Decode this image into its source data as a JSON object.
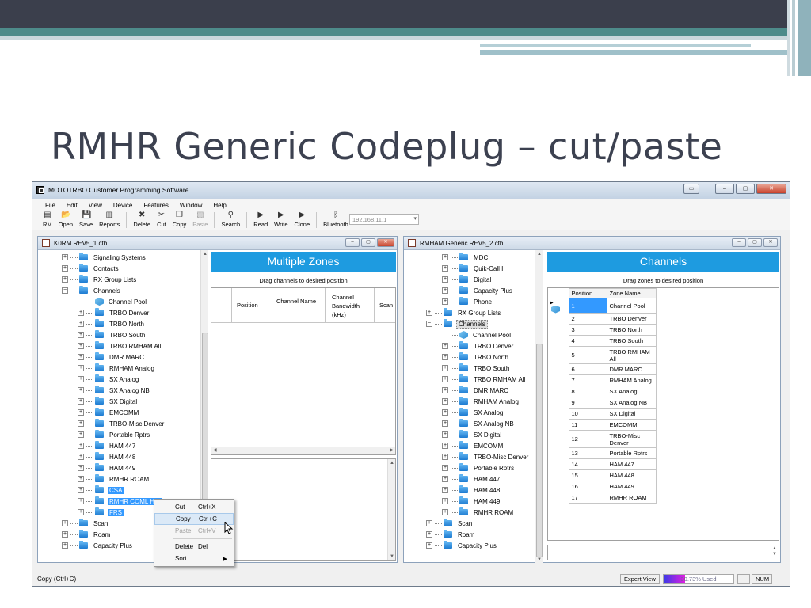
{
  "slide": {
    "title": "RMHR Generic Codeplug – cut/paste"
  },
  "app": {
    "title": "MOTOTRBO Customer Programming Software",
    "menu": [
      "File",
      "Edit",
      "View",
      "Device",
      "Features",
      "Window",
      "Help"
    ],
    "toolbar": [
      {
        "icon": "rm-icon",
        "glyph": "▤",
        "label": "RM",
        "enabled": true
      },
      {
        "icon": "open-folder-icon",
        "glyph": "📂",
        "label": "Open",
        "enabled": true
      },
      {
        "icon": "save-disk-icon",
        "glyph": "💾",
        "label": "Save",
        "enabled": true
      },
      {
        "icon": "reports-icon",
        "glyph": "▥",
        "label": "Reports",
        "enabled": true
      },
      {
        "icon": "delete-x-icon",
        "glyph": "✖",
        "label": "Delete",
        "enabled": true
      },
      {
        "icon": "scissors-icon",
        "glyph": "✂",
        "label": "Cut",
        "enabled": true
      },
      {
        "icon": "copy-icon",
        "glyph": "❐",
        "label": "Copy",
        "enabled": true
      },
      {
        "icon": "paste-icon",
        "glyph": "▧",
        "label": "Paste",
        "enabled": false
      },
      {
        "icon": "search-icon",
        "glyph": "⚲",
        "label": "Search",
        "enabled": true
      },
      {
        "icon": "read-icon",
        "glyph": "▶",
        "label": "Read",
        "enabled": true
      },
      {
        "icon": "write-icon",
        "glyph": "▶",
        "label": "Write",
        "enabled": true
      },
      {
        "icon": "clone-icon",
        "glyph": "▶",
        "label": "Clone",
        "enabled": true
      },
      {
        "icon": "bluetooth-icon",
        "glyph": "ᛒ",
        "label": "Bluetooth",
        "enabled": true
      }
    ],
    "ip_address": "192.168.11.1",
    "status": {
      "message": "Copy (Ctrl+C)",
      "view": "Expert View",
      "usage_text": "30.73% Used",
      "usage_fraction": 0.3073,
      "num": "NUM"
    }
  },
  "left_pane": {
    "title": "K0RM REV5_1.ctb",
    "tree": [
      {
        "label": "Signaling Systems",
        "level": 1,
        "icon": "folder",
        "state": ""
      },
      {
        "label": "Contacts",
        "level": 1,
        "icon": "folder",
        "state": ""
      },
      {
        "label": "RX Group Lists",
        "level": 1,
        "icon": "folder",
        "state": ""
      },
      {
        "label": "Channels",
        "level": 1,
        "icon": "folder-open",
        "state": "",
        "expanded": true
      },
      {
        "label": "Channel Pool",
        "level": 2,
        "icon": "cube",
        "state": ""
      },
      {
        "label": "TRBO Denver",
        "level": 2,
        "icon": "folder",
        "state": ""
      },
      {
        "label": "TRBO North",
        "level": 2,
        "icon": "folder",
        "state": ""
      },
      {
        "label": "TRBO South",
        "level": 2,
        "icon": "folder",
        "state": ""
      },
      {
        "label": "TRBO RMHAM All",
        "level": 2,
        "icon": "folder",
        "state": ""
      },
      {
        "label": "DMR MARC",
        "level": 2,
        "icon": "folder",
        "state": ""
      },
      {
        "label": "RMHAM Analog",
        "level": 2,
        "icon": "folder",
        "state": ""
      },
      {
        "label": "SX Analog",
        "level": 2,
        "icon": "folder",
        "state": ""
      },
      {
        "label": "SX Analog NB",
        "level": 2,
        "icon": "folder",
        "state": ""
      },
      {
        "label": "SX Digital",
        "level": 2,
        "icon": "folder",
        "state": ""
      },
      {
        "label": "EMCOMM",
        "level": 2,
        "icon": "folder",
        "state": ""
      },
      {
        "label": "TRBO-Misc Denver",
        "level": 2,
        "icon": "folder",
        "state": ""
      },
      {
        "label": "Portable Rptrs",
        "level": 2,
        "icon": "folder",
        "state": ""
      },
      {
        "label": "HAM 447",
        "level": 2,
        "icon": "folder",
        "state": ""
      },
      {
        "label": "HAM 448",
        "level": 2,
        "icon": "folder",
        "state": ""
      },
      {
        "label": "HAM 449",
        "level": 2,
        "icon": "folder",
        "state": ""
      },
      {
        "label": "RMHR ROAM",
        "level": 2,
        "icon": "folder",
        "state": ""
      },
      {
        "label": "CSA",
        "level": 2,
        "icon": "folder",
        "state": "sel"
      },
      {
        "label": "RMHR COML HTs",
        "level": 2,
        "icon": "folder",
        "state": "sel"
      },
      {
        "label": "FRS",
        "level": 2,
        "icon": "folder",
        "state": "sel"
      },
      {
        "label": "Scan",
        "level": 1,
        "icon": "folder",
        "state": ""
      },
      {
        "label": "Roam",
        "level": 1,
        "icon": "folder",
        "state": ""
      },
      {
        "label": "Capacity Plus",
        "level": 1,
        "icon": "folder",
        "state": ""
      }
    ],
    "panel_heading": "Multiple Zones",
    "panel_caption": "Drag channels to desired position",
    "columns": [
      "Position",
      "Channel Name",
      "Channel Bandwidth (kHz)",
      "Scan"
    ]
  },
  "right_pane": {
    "title": "RMHAM Generic REV5_2.ctb",
    "tree": [
      {
        "label": "MDC",
        "level": 2,
        "icon": "folder",
        "state": ""
      },
      {
        "label": "Quik-Call II",
        "level": 2,
        "icon": "folder",
        "state": ""
      },
      {
        "label": "Digital",
        "level": 2,
        "icon": "folder",
        "state": ""
      },
      {
        "label": "Capacity Plus",
        "level": 2,
        "icon": "folder",
        "state": ""
      },
      {
        "label": "Phone",
        "level": 2,
        "icon": "folder",
        "state": ""
      },
      {
        "label": "RX Group Lists",
        "level": 1,
        "icon": "folder",
        "state": ""
      },
      {
        "label": "Channels",
        "level": 1,
        "icon": "folder-open",
        "state": "grey",
        "expanded": true
      },
      {
        "label": "Channel Pool",
        "level": 2,
        "icon": "cube",
        "state": ""
      },
      {
        "label": "TRBO Denver",
        "level": 2,
        "icon": "folder",
        "state": ""
      },
      {
        "label": "TRBO North",
        "level": 2,
        "icon": "folder",
        "state": ""
      },
      {
        "label": "TRBO South",
        "level": 2,
        "icon": "folder",
        "state": ""
      },
      {
        "label": "TRBO RMHAM All",
        "level": 2,
        "icon": "folder",
        "state": ""
      },
      {
        "label": "DMR MARC",
        "level": 2,
        "icon": "folder",
        "state": ""
      },
      {
        "label": "RMHAM Analog",
        "level": 2,
        "icon": "folder",
        "state": ""
      },
      {
        "label": "SX Analog",
        "level": 2,
        "icon": "folder",
        "state": ""
      },
      {
        "label": "SX Analog NB",
        "level": 2,
        "icon": "folder",
        "state": ""
      },
      {
        "label": "SX Digital",
        "level": 2,
        "icon": "folder",
        "state": ""
      },
      {
        "label": "EMCOMM",
        "level": 2,
        "icon": "folder",
        "state": ""
      },
      {
        "label": "TRBO-Misc Denver",
        "level": 2,
        "icon": "folder",
        "state": ""
      },
      {
        "label": "Portable Rptrs",
        "level": 2,
        "icon": "folder",
        "state": ""
      },
      {
        "label": "HAM 447",
        "level": 2,
        "icon": "folder",
        "state": ""
      },
      {
        "label": "HAM 448",
        "level": 2,
        "icon": "folder",
        "state": ""
      },
      {
        "label": "HAM 449",
        "level": 2,
        "icon": "folder",
        "state": ""
      },
      {
        "label": "RMHR ROAM",
        "level": 2,
        "icon": "folder",
        "state": ""
      },
      {
        "label": "Scan",
        "level": 1,
        "icon": "folder",
        "state": ""
      },
      {
        "label": "Roam",
        "level": 1,
        "icon": "folder",
        "state": ""
      },
      {
        "label": "Capacity Plus",
        "level": 1,
        "icon": "folder",
        "state": ""
      }
    ],
    "panel_heading": "Channels",
    "panel_caption": "Drag zones to desired position",
    "columns": [
      "Position",
      "Zone Name"
    ],
    "rows": [
      {
        "position": "1",
        "zone": "Channel Pool",
        "selected": true
      },
      {
        "position": "2",
        "zone": "TRBO Denver"
      },
      {
        "position": "3",
        "zone": "TRBO North"
      },
      {
        "position": "4",
        "zone": "TRBO South"
      },
      {
        "position": "5",
        "zone": "TRBO RMHAM All",
        "tall": true
      },
      {
        "position": "6",
        "zone": "DMR MARC"
      },
      {
        "position": "7",
        "zone": "RMHAM Analog"
      },
      {
        "position": "8",
        "zone": "SX Analog"
      },
      {
        "position": "9",
        "zone": "SX Analog NB"
      },
      {
        "position": "10",
        "zone": "SX Digital"
      },
      {
        "position": "11",
        "zone": "EMCOMM"
      },
      {
        "position": "12",
        "zone": "TRBO-Misc Denver",
        "tall": true
      },
      {
        "position": "13",
        "zone": "Portable Rptrs"
      },
      {
        "position": "14",
        "zone": "HAM 447"
      },
      {
        "position": "15",
        "zone": "HAM 448"
      },
      {
        "position": "16",
        "zone": "HAM 449"
      },
      {
        "position": "17",
        "zone": "RMHR ROAM"
      }
    ]
  },
  "context_menu": [
    {
      "label": "Cut",
      "shortcut": "Ctrl+X",
      "state": ""
    },
    {
      "label": "Copy",
      "shortcut": "Ctrl+C",
      "state": "hl"
    },
    {
      "label": "Paste",
      "shortcut": "Ctrl+V",
      "state": "dis"
    },
    {
      "sep": true
    },
    {
      "label": "Delete",
      "shortcut": "Del",
      "state": ""
    },
    {
      "label": "Sort",
      "shortcut": "",
      "state": "",
      "submenu": true
    }
  ]
}
